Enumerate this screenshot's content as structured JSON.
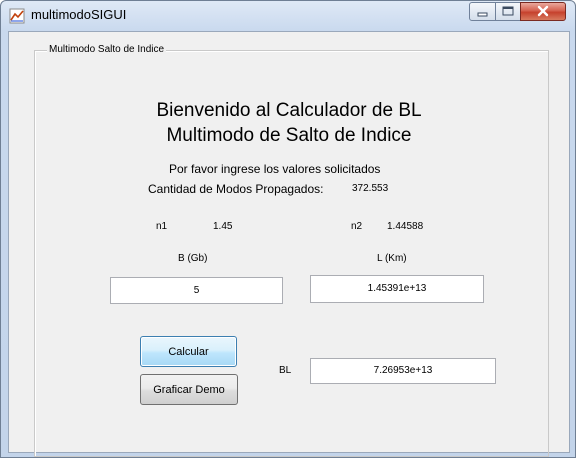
{
  "window": {
    "title": "multimodoSIGUI",
    "icon": "matlab-figure-icon"
  },
  "panel": {
    "title": "Multimodo Salto de Indice"
  },
  "heading": {
    "line1": "Bienvenido al Calculador de BL",
    "line2": "Multimodo de Salto de Indice"
  },
  "instructions": "Por favor ingrese los valores solicitados",
  "modes": {
    "label": "Cantidad de Modos Propagados:",
    "value": "372.553"
  },
  "n1": {
    "label": "n1",
    "value": "1.45"
  },
  "n2": {
    "label": "n2",
    "value": "1.44588"
  },
  "b": {
    "label": "B (Gb)",
    "value": "5"
  },
  "l": {
    "label": "L (Km)",
    "value": "1.45391e+13"
  },
  "buttons": {
    "calcular": "Calcular",
    "graficar": "Graficar Demo"
  },
  "bl": {
    "label": "BL",
    "value": "7.26953e+13"
  }
}
